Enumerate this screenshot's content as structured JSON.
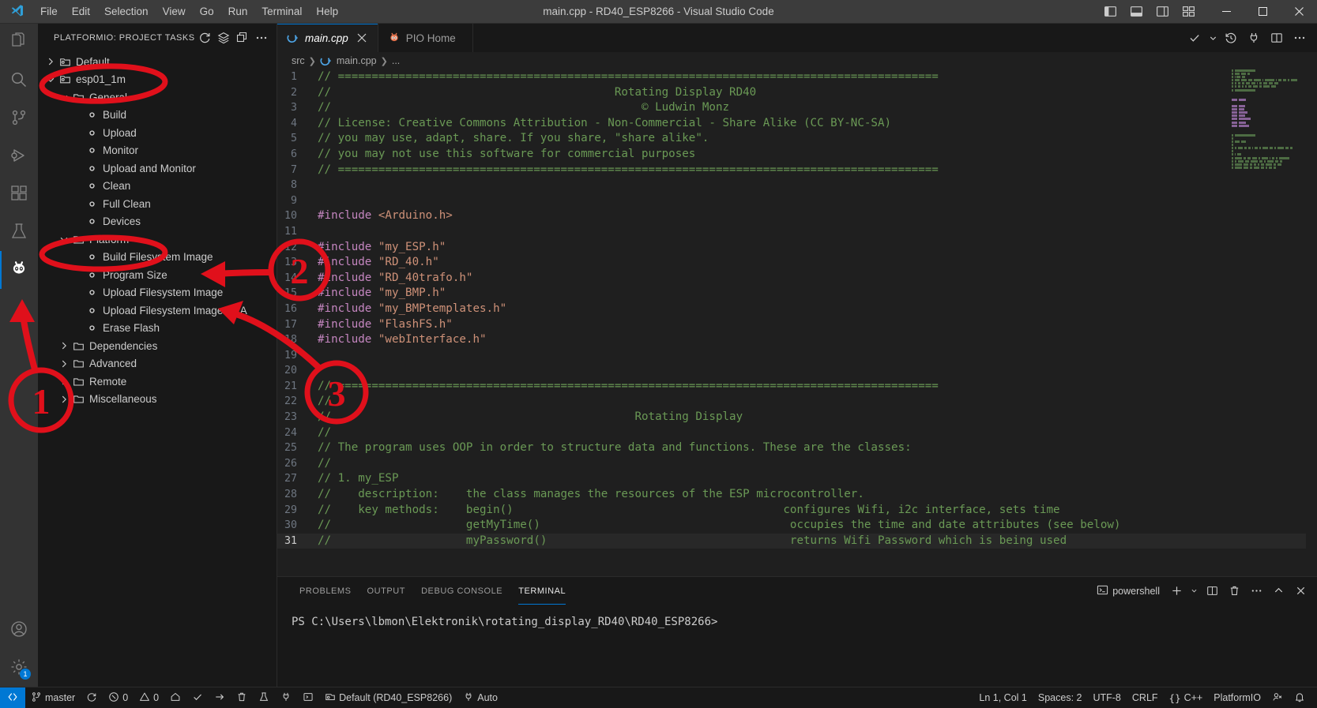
{
  "window": {
    "title": "main.cpp - RD40_ESP8266 - Visual Studio Code",
    "menu": [
      "File",
      "Edit",
      "Selection",
      "View",
      "Go",
      "Run",
      "Terminal",
      "Help"
    ],
    "controls": {
      "minimize": "minimize-button",
      "maximize": "maximize-button",
      "close": "close-button"
    },
    "layout_toggles": [
      "toggle-primary-sidebar",
      "toggle-panel",
      "toggle-secondary-sidebar",
      "customize-layout"
    ]
  },
  "activitybar": {
    "items": [
      {
        "name": "explorer",
        "icon": "files-icon",
        "active": false
      },
      {
        "name": "search",
        "icon": "search-icon",
        "active": false
      },
      {
        "name": "source-control",
        "icon": "source-control-icon",
        "active": false
      },
      {
        "name": "run-and-debug",
        "icon": "debug-icon",
        "active": false
      },
      {
        "name": "extensions",
        "icon": "extensions-icon",
        "active": false
      },
      {
        "name": "testing",
        "icon": "beaker-icon",
        "active": false
      },
      {
        "name": "platformio",
        "icon": "platformio-alien-icon",
        "active": true
      }
    ],
    "bottom": [
      {
        "name": "accounts",
        "icon": "account-icon",
        "badge": ""
      },
      {
        "name": "manage",
        "icon": "gear-icon",
        "badge": "1"
      }
    ]
  },
  "sidebar": {
    "header": "PLATFORMIO: PROJECT TASKS",
    "actions": [
      "refresh-icon",
      "layers-icon",
      "collapse-all-icon",
      "more-actions-icon"
    ],
    "tree": [
      {
        "label": "Default",
        "type": "env",
        "indent": 0,
        "twisty": "collapsed",
        "icon": "env-icon"
      },
      {
        "label": "esp01_1m",
        "type": "env",
        "indent": 0,
        "twisty": "expanded",
        "icon": "env-icon"
      },
      {
        "label": "General",
        "type": "folder",
        "indent": 1,
        "twisty": "expanded",
        "icon": "folder-icon"
      },
      {
        "label": "Build",
        "type": "task",
        "indent": 2,
        "twisty": "none",
        "icon": "task-dot-icon"
      },
      {
        "label": "Upload",
        "type": "task",
        "indent": 2,
        "twisty": "none",
        "icon": "task-dot-icon"
      },
      {
        "label": "Monitor",
        "type": "task",
        "indent": 2,
        "twisty": "none",
        "icon": "task-dot-icon"
      },
      {
        "label": "Upload and Monitor",
        "type": "task",
        "indent": 2,
        "twisty": "none",
        "icon": "task-dot-icon"
      },
      {
        "label": "Clean",
        "type": "task",
        "indent": 2,
        "twisty": "none",
        "icon": "task-dot-icon"
      },
      {
        "label": "Full Clean",
        "type": "task",
        "indent": 2,
        "twisty": "none",
        "icon": "task-dot-icon"
      },
      {
        "label": "Devices",
        "type": "task",
        "indent": 2,
        "twisty": "none",
        "icon": "task-dot-icon"
      },
      {
        "label": "Platform",
        "type": "folder",
        "indent": 1,
        "twisty": "expanded",
        "icon": "folder-icon"
      },
      {
        "label": "Build Filesystem Image",
        "type": "task",
        "indent": 2,
        "twisty": "none",
        "icon": "task-dot-icon"
      },
      {
        "label": "Program Size",
        "type": "task",
        "indent": 2,
        "twisty": "none",
        "icon": "task-dot-icon"
      },
      {
        "label": "Upload Filesystem Image",
        "type": "task",
        "indent": 2,
        "twisty": "none",
        "icon": "task-dot-icon"
      },
      {
        "label": "Upload Filesystem Image OTA",
        "type": "task",
        "indent": 2,
        "twisty": "none",
        "icon": "task-dot-icon"
      },
      {
        "label": "Erase Flash",
        "type": "task",
        "indent": 2,
        "twisty": "none",
        "icon": "task-dot-icon"
      },
      {
        "label": "Dependencies",
        "type": "folder",
        "indent": 1,
        "twisty": "collapsed",
        "icon": "folder-icon"
      },
      {
        "label": "Advanced",
        "type": "folder",
        "indent": 1,
        "twisty": "collapsed",
        "icon": "folder-icon"
      },
      {
        "label": "Remote",
        "type": "folder",
        "indent": 1,
        "twisty": "collapsed",
        "icon": "folder-icon"
      },
      {
        "label": "Miscellaneous",
        "type": "folder",
        "indent": 1,
        "twisty": "collapsed",
        "icon": "folder-icon"
      }
    ]
  },
  "editor": {
    "tabs": [
      {
        "label": "main.cpp",
        "icon": "cpp-file-icon",
        "active": true,
        "closable": true
      },
      {
        "label": "PIO Home",
        "icon": "platformio-icon",
        "active": false,
        "closable": false
      }
    ],
    "toolbar": [
      "check-icon",
      "chevron-down-icon",
      "history-icon",
      "plug-icon",
      "split-editor-icon",
      "more-actions-icon"
    ],
    "breadcrumb": [
      "src",
      "main.cpp",
      "..."
    ],
    "lines": [
      {
        "n": 1,
        "text": "// ========================================================================================="
      },
      {
        "n": 2,
        "text": "//                                          Rotating Display RD40"
      },
      {
        "n": 3,
        "text": "//                                              © Ludwin Monz"
      },
      {
        "n": 4,
        "text": "// License: Creative Commons Attribution - Non-Commercial - Share Alike (CC BY-NC-SA)"
      },
      {
        "n": 5,
        "text": "// you may use, adapt, share. If you share, \"share alike\"."
      },
      {
        "n": 6,
        "text": "// you may not use this software for commercial purposes"
      },
      {
        "n": 7,
        "text": "// ========================================================================================="
      },
      {
        "n": 8,
        "text": ""
      },
      {
        "n": 9,
        "text": ""
      },
      {
        "n": 10,
        "text": "#include <Arduino.h>",
        "kind": "include"
      },
      {
        "n": 11,
        "text": ""
      },
      {
        "n": 12,
        "text": "#include \"my_ESP.h\"",
        "kind": "include"
      },
      {
        "n": 13,
        "text": "#include \"RD_40.h\"",
        "kind": "include"
      },
      {
        "n": 14,
        "text": "#include \"RD_40trafo.h\"",
        "kind": "include"
      },
      {
        "n": 15,
        "text": "#include \"my_BMP.h\"",
        "kind": "include"
      },
      {
        "n": 16,
        "text": "#include \"my_BMPtemplates.h\"",
        "kind": "include"
      },
      {
        "n": 17,
        "text": "#include \"FlashFS.h\"",
        "kind": "include"
      },
      {
        "n": 18,
        "text": "#include \"webInterface.h\"",
        "kind": "include"
      },
      {
        "n": 19,
        "text": ""
      },
      {
        "n": 20,
        "text": ""
      },
      {
        "n": 21,
        "text": "// ========================================================================================="
      },
      {
        "n": 22,
        "text": "//"
      },
      {
        "n": 23,
        "text": "//                                             Rotating Display"
      },
      {
        "n": 24,
        "text": "//"
      },
      {
        "n": 25,
        "text": "// The program uses OOP in order to structure data and functions. These are the classes:"
      },
      {
        "n": 26,
        "text": "//"
      },
      {
        "n": 27,
        "text": "// 1. my_ESP"
      },
      {
        "n": 28,
        "text": "//    description:    the class manages the resources of the ESP microcontroller."
      },
      {
        "n": 29,
        "text": "//    key methods:    begin()                                        configures Wifi, i2c interface, sets time"
      },
      {
        "n": 30,
        "text": "//                    getMyTime()                                     occupies the time and date attributes (see below)"
      },
      {
        "n": 31,
        "text": "//                    myPassword()                                    returns Wifi Password which is being used",
        "current": true
      }
    ]
  },
  "panel": {
    "tabs": [
      "PROBLEMS",
      "OUTPUT",
      "DEBUG CONSOLE",
      "TERMINAL"
    ],
    "active_tab": "TERMINAL",
    "shell": "powershell",
    "shell_icon": "terminal-icon",
    "actions": [
      "add-terminal-icon",
      "chevron-down-icon",
      "split-terminal-icon",
      "kill-terminal-icon",
      "more-actions-icon",
      "maximize-panel-icon",
      "close-panel-icon"
    ],
    "terminal_line": "PS C:\\Users\\lbmon\\Elektronik\\rotating_display_RD40\\RD40_ESP8266>"
  },
  "statusbar": {
    "remote_icon": "remote-window-icon",
    "left": [
      {
        "label": "master",
        "icon": "source-control-branch-icon"
      },
      {
        "label": "",
        "icon": "sync-icon"
      },
      {
        "label": "0",
        "icon": "error-icon"
      },
      {
        "label": "0",
        "icon": "warning-icon"
      },
      {
        "label": "",
        "icon": "pio-home-icon"
      },
      {
        "label": "",
        "icon": "pio-build-icon"
      },
      {
        "label": "",
        "icon": "pio-upload-icon"
      },
      {
        "label": "",
        "icon": "pio-clean-icon"
      },
      {
        "label": "",
        "icon": "pio-test-icon"
      },
      {
        "label": "",
        "icon": "pio-monitor-icon"
      },
      {
        "label": "",
        "icon": "pio-terminal-icon"
      },
      {
        "label": "Default (RD40_ESP8266)",
        "icon": "env-icon"
      },
      {
        "label": "Auto",
        "icon": "plug-icon"
      }
    ],
    "right": [
      {
        "label": "Ln 1, Col 1",
        "icon": ""
      },
      {
        "label": "Spaces: 2",
        "icon": ""
      },
      {
        "label": "UTF-8",
        "icon": ""
      },
      {
        "label": "CRLF",
        "icon": ""
      },
      {
        "label": "C++",
        "icon": "braces-icon"
      },
      {
        "label": "PlatformIO",
        "icon": ""
      },
      {
        "label": "",
        "icon": "feedback-icon"
      },
      {
        "label": "",
        "icon": "bell-icon"
      }
    ]
  },
  "annotations": {
    "color": "#e0101b",
    "markers": [
      {
        "id": "1",
        "label": "1",
        "target": "platformio-activity-icon"
      },
      {
        "id": "2",
        "label": "2",
        "target": "build-filesystem-image"
      },
      {
        "id": "3",
        "label": "3",
        "target": "upload-filesystem-image"
      }
    ],
    "ellipses": [
      "esp01_1m-row",
      "platform-row"
    ]
  }
}
